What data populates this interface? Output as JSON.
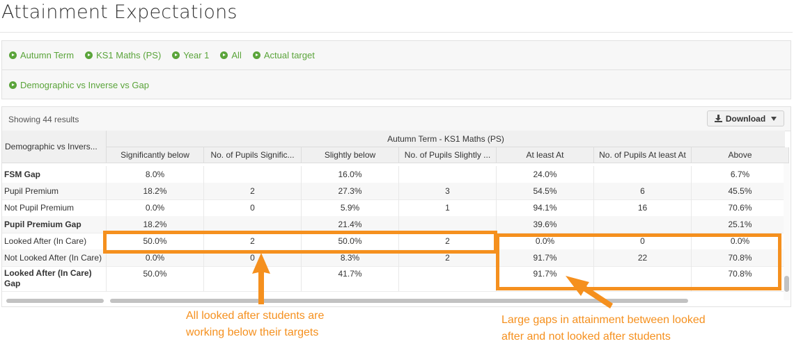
{
  "page": {
    "title": "Attainment Expectations"
  },
  "filters": {
    "row1": [
      "Autumn Term",
      "KS1 Maths (PS)",
      "Year 1",
      "All",
      "Actual target"
    ],
    "row2": [
      "Demographic vs Inverse vs Gap"
    ]
  },
  "results": {
    "showing": "Showing 44 results",
    "download_label": "Download"
  },
  "table": {
    "row_header": "Demographic vs Invers...",
    "group_header": "Autumn Term - KS1 Maths (PS)",
    "columns": [
      "Significantly below",
      "No. of Pupils Signific...",
      "Slightly below",
      "No. of Pupils Slightly ...",
      "At least At",
      "No. of Pupils At least At",
      "Above"
    ],
    "rows": [
      {
        "label": "FSM Gap",
        "bold": true,
        "cells": [
          "8.0%",
          "",
          "16.0%",
          "",
          "24.0%",
          "",
          "6.7%"
        ]
      },
      {
        "label": "Pupil Premium",
        "bold": false,
        "cells": [
          "18.2%",
          "2",
          "27.3%",
          "3",
          "54.5%",
          "6",
          "45.5%"
        ]
      },
      {
        "label": "Not Pupil Premium",
        "bold": false,
        "cells": [
          "0.0%",
          "0",
          "5.9%",
          "1",
          "94.1%",
          "16",
          "70.6%"
        ]
      },
      {
        "label": "Pupil Premium Gap",
        "bold": true,
        "cells": [
          "18.2%",
          "",
          "21.4%",
          "",
          "39.6%",
          "",
          "25.1%"
        ]
      },
      {
        "label": "Looked After (In Care)",
        "bold": false,
        "cells": [
          "50.0%",
          "2",
          "50.0%",
          "2",
          "0.0%",
          "0",
          "0.0%"
        ]
      },
      {
        "label": "Not Looked After (In Care)",
        "bold": false,
        "cells": [
          "0.0%",
          "0",
          "8.3%",
          "2",
          "91.7%",
          "22",
          "70.8%"
        ]
      },
      {
        "label": "Looked After (In Care) Gap",
        "bold": true,
        "cells": [
          "50.0%",
          "",
          "41.7%",
          "",
          "91.7%",
          "",
          "70.8%"
        ]
      }
    ]
  },
  "annotations": {
    "left_note": [
      "All looked after students are",
      "working below their targets"
    ],
    "right_note": [
      "Large gaps in attainment between looked",
      "after and not looked after students"
    ],
    "color": "#f5901e"
  }
}
